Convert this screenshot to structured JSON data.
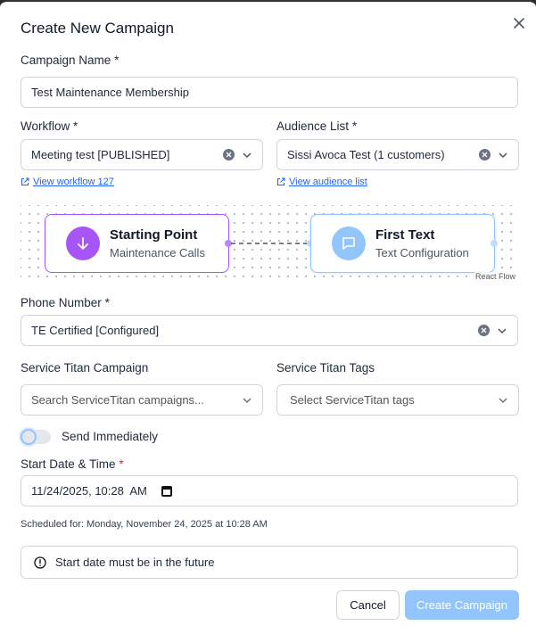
{
  "modal": {
    "title": "Create New Campaign"
  },
  "campaign_name": {
    "label": "Campaign Name",
    "required_mark": "*",
    "value": "Test Maintenance Membership"
  },
  "workflow": {
    "label": "Workflow",
    "required_mark": "*",
    "value": "Meeting test [PUBLISHED]",
    "link_text": "View workflow 127"
  },
  "audience": {
    "label": "Audience List",
    "required_mark": "*",
    "value": "Sissi Avoca Test (1 customers)",
    "link_text": "View audience list"
  },
  "flow": {
    "start_node": {
      "title": "Starting Point",
      "subtitle": "Maintenance Calls",
      "icon": "arrow-down-icon",
      "color": "#a855f7"
    },
    "text_node": {
      "title": "First Text",
      "subtitle": "Text Configuration",
      "icon": "message-icon",
      "color": "#93c5fd"
    },
    "attribution": "React Flow"
  },
  "phone": {
    "label": "Phone Number",
    "required_mark": "*",
    "value": "TE Certified [Configured]"
  },
  "st_campaign": {
    "label": "Service Titan Campaign",
    "placeholder": "Search ServiceTitan campaigns..."
  },
  "st_tags": {
    "label": "Service Titan Tags",
    "placeholder": "Select ServiceTitan tags"
  },
  "send_immediately": {
    "label": "Send Immediately",
    "checked": false
  },
  "start_date": {
    "label": "Start Date & Time",
    "required_mark": "*",
    "value": "11/24/2025, 10:28  AM"
  },
  "scheduled_text": "Scheduled for: Monday, November 24, 2025 at 10:28 AM",
  "warning": {
    "text": "Start date must be in the future",
    "icon": "alert-circle-icon"
  },
  "buttons": {
    "cancel": "Cancel",
    "create": "Create Campaign"
  },
  "colors": {
    "accent": "#2563eb",
    "primary_disabled": "#93c5fd",
    "required": "#dc2626"
  }
}
